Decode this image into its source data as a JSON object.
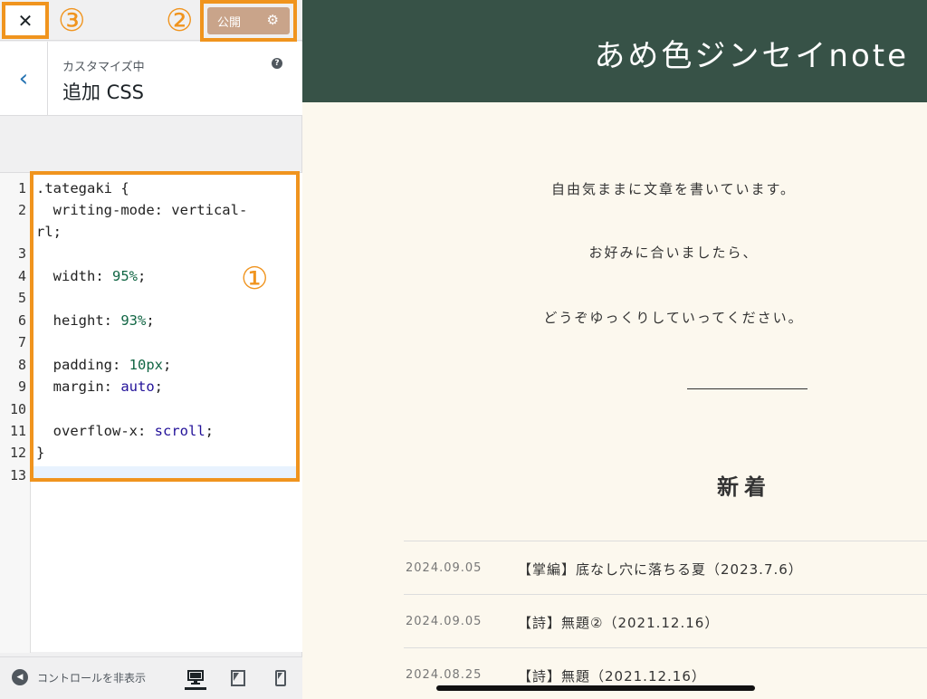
{
  "panel": {
    "close_label": "✕",
    "publish_label": "公開",
    "customizing_label": "カスタマイズ中",
    "section_title": "追加 CSS",
    "help_label": "?"
  },
  "markers": {
    "one": "①",
    "two": "②",
    "three": "③"
  },
  "editor": {
    "line_numbers": [
      "1",
      "2",
      "",
      "3",
      "4",
      "5",
      "6",
      "7",
      "8",
      "9",
      "10",
      "11",
      "12",
      "13"
    ],
    "lines": {
      "l1": ".tategaki {",
      "l2": "  writing-mode: vertical-",
      "l2b": "rl;",
      "l4_prop": "  width: ",
      "l4_val": "95%",
      "l6_prop": "  height: ",
      "l6_val": "93%",
      "l8_prop": "  padding: ",
      "l8_val": "10px",
      "l9_prop": "  margin: ",
      "l9_val": "auto",
      "l11_prop": "  overflow-x: ",
      "l11_val": "scroll",
      "l12": "}",
      "semi": ";"
    }
  },
  "footer": {
    "hide_controls_label": "コントロールを非表示"
  },
  "preview": {
    "site_title": "あめ色ジンセイnote",
    "intro": [
      "自由気ままに文章を書いています。",
      "お好みに合いましたら、",
      "どうぞゆっくりしていってください。"
    ],
    "news_heading": "新着",
    "posts": [
      {
        "date": "2024.09.05",
        "title": "【掌編】底なし穴に落ちる夏（2023.7.6）"
      },
      {
        "date": "2024.09.05",
        "title": "【詩】無題②（2021.12.16）"
      },
      {
        "date": "2024.08.25",
        "title": "【詩】無題（2021.12.16）"
      }
    ]
  },
  "colors": {
    "accent_marker": "#f0941e",
    "header_bg": "#375247",
    "publish_bg": "#c9a48a",
    "preview_bg": "#fcf8ee"
  }
}
